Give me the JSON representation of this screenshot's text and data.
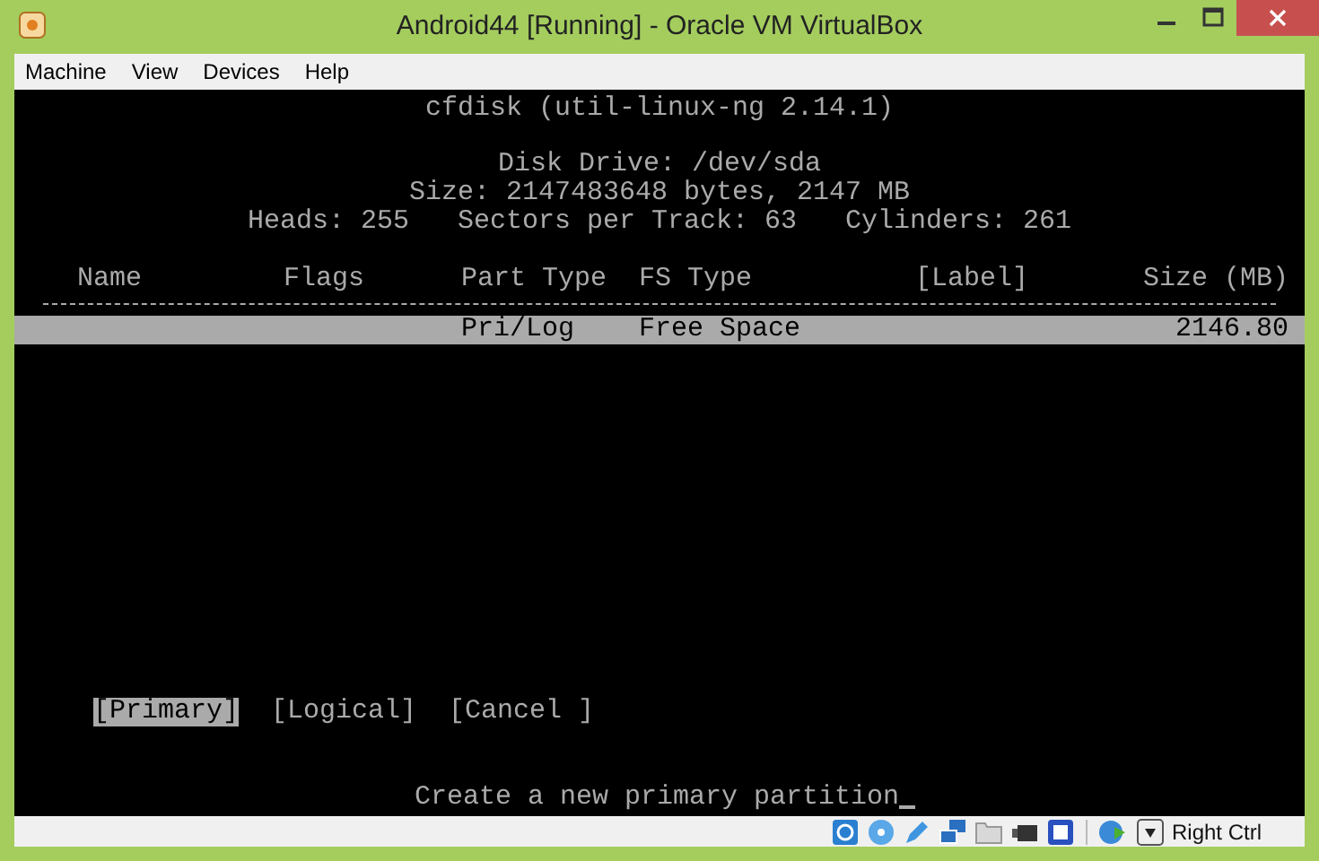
{
  "window": {
    "title": "Android44 [Running] - Oracle VM VirtualBox"
  },
  "menu": [
    "Machine",
    "View",
    "Devices",
    "Help"
  ],
  "terminal": {
    "title": "cfdisk (util-linux-ng 2.14.1)",
    "info": [
      "Disk Drive: /dev/sda",
      "Size: 2147483648 bytes, 2147 MB",
      "Heads: 255   Sectors per Track: 63   Cylinders: 261"
    ],
    "columns": [
      "Name",
      "Flags",
      "Part Type",
      "FS Type",
      "[Label]",
      "Size (MB)"
    ],
    "rows": [
      {
        "selected": true,
        "cells": [
          "",
          "",
          "Pri/Log",
          "Free Space",
          "",
          "2146.80"
        ]
      }
    ],
    "actions": [
      {
        "label": "[Primary]",
        "selected": true
      },
      {
        "label": "[Logical]",
        "selected": false
      },
      {
        "label": "[Cancel ]",
        "selected": false
      }
    ],
    "prompt": "Create a new primary partition"
  },
  "status_bar": {
    "host_key": "Right Ctrl"
  }
}
